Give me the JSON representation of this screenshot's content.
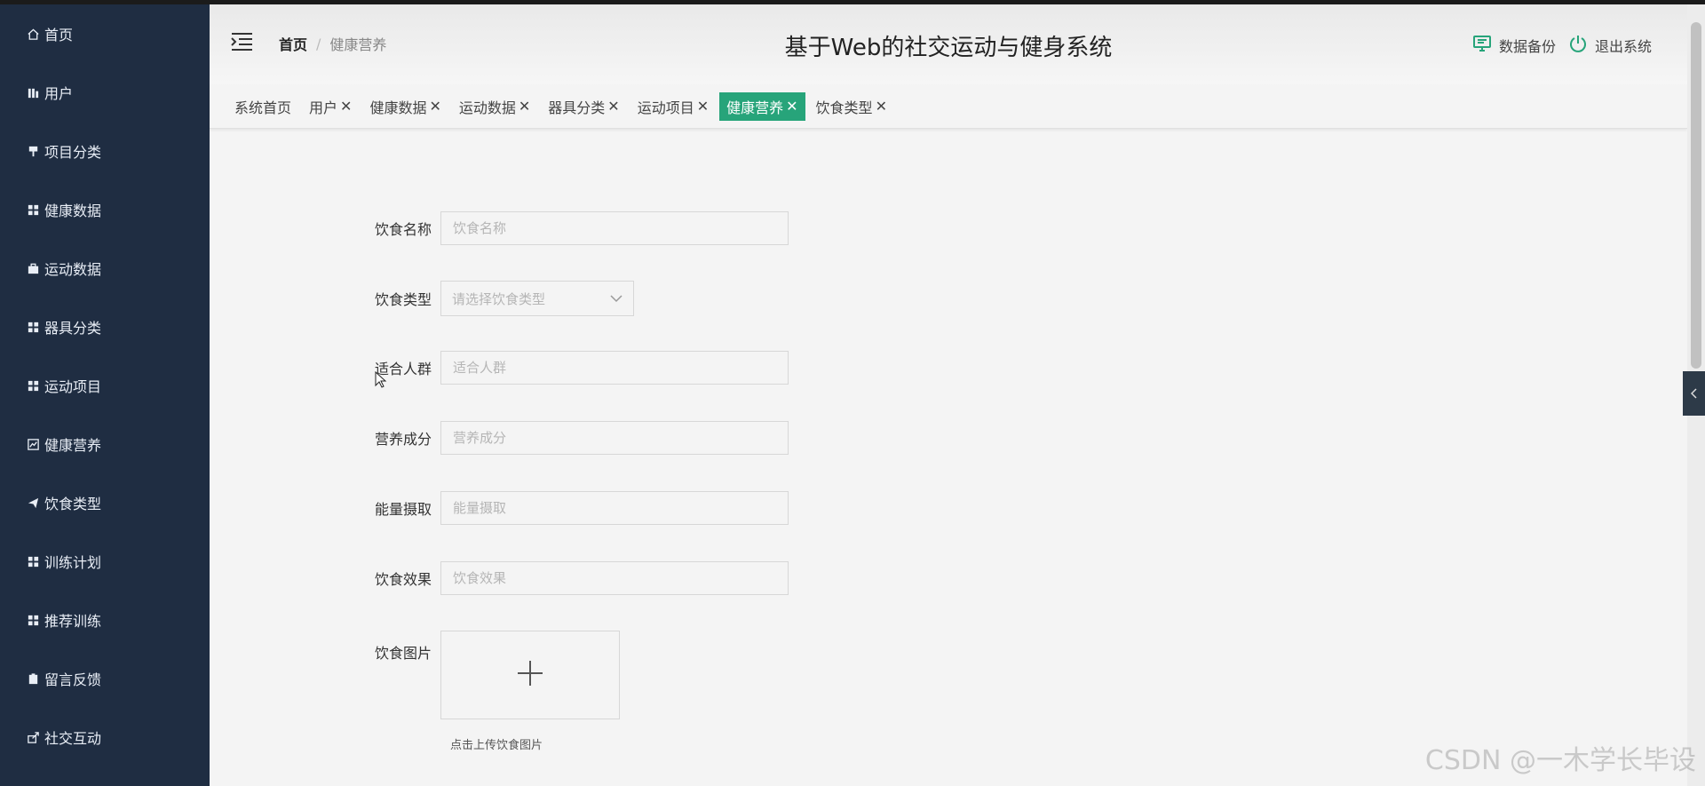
{
  "sidebar": {
    "items": [
      {
        "label": "首页",
        "icon": "home-icon"
      },
      {
        "label": "用户",
        "icon": "chart-icon"
      },
      {
        "label": "项目分类",
        "icon": "paint-icon"
      },
      {
        "label": "健康数据",
        "icon": "grid-icon"
      },
      {
        "label": "运动数据",
        "icon": "briefcase-icon"
      },
      {
        "label": "器具分类",
        "icon": "grid-icon"
      },
      {
        "label": "运动项目",
        "icon": "grid-icon"
      },
      {
        "label": "健康营养",
        "icon": "line-chart-icon"
      },
      {
        "label": "饮食类型",
        "icon": "send-icon"
      },
      {
        "label": "训练计划",
        "icon": "grid-icon"
      },
      {
        "label": "推荐训练",
        "icon": "grid-icon"
      },
      {
        "label": "留言反馈",
        "icon": "clipboard-icon"
      },
      {
        "label": "社交互动",
        "icon": "share-icon"
      }
    ]
  },
  "header": {
    "breadcrumb_home": "首页",
    "breadcrumb_sep": "/",
    "breadcrumb_current": "健康营养",
    "title": "基于Web的社交运动与健身系统",
    "backup_label": "数据备份",
    "logout_label": "退出系统"
  },
  "tabs": [
    {
      "label": "系统首页",
      "closable": false,
      "active": false
    },
    {
      "label": "用户",
      "closable": true,
      "active": false
    },
    {
      "label": "健康数据",
      "closable": true,
      "active": false
    },
    {
      "label": "运动数据",
      "closable": true,
      "active": false
    },
    {
      "label": "器具分类",
      "closable": true,
      "active": false
    },
    {
      "label": "运动项目",
      "closable": true,
      "active": false
    },
    {
      "label": "健康营养",
      "closable": true,
      "active": true
    },
    {
      "label": "饮食类型",
      "closable": true,
      "active": false
    }
  ],
  "tab_close_glyph": "✕",
  "form": {
    "food_name": {
      "label": "饮食名称",
      "placeholder": "饮食名称",
      "value": ""
    },
    "food_type": {
      "label": "饮食类型",
      "placeholder": "请选择饮食类型"
    },
    "target_group": {
      "label": "适合人群",
      "placeholder": "适合人群",
      "value": ""
    },
    "nutrients": {
      "label": "营养成分",
      "placeholder": "营养成分",
      "value": ""
    },
    "energy": {
      "label": "能量摄取",
      "placeholder": "能量摄取",
      "value": ""
    },
    "effect": {
      "label": "饮食效果",
      "placeholder": "饮食效果",
      "value": ""
    },
    "image": {
      "label": "饮食图片",
      "tip": "点击上传饮食图片"
    }
  },
  "watermark": "CSDN @一木学长毕设",
  "colors": {
    "sidebar_bg": "#1f2d42",
    "accent": "#27a47a",
    "page_bg": "#f4f4f4"
  }
}
